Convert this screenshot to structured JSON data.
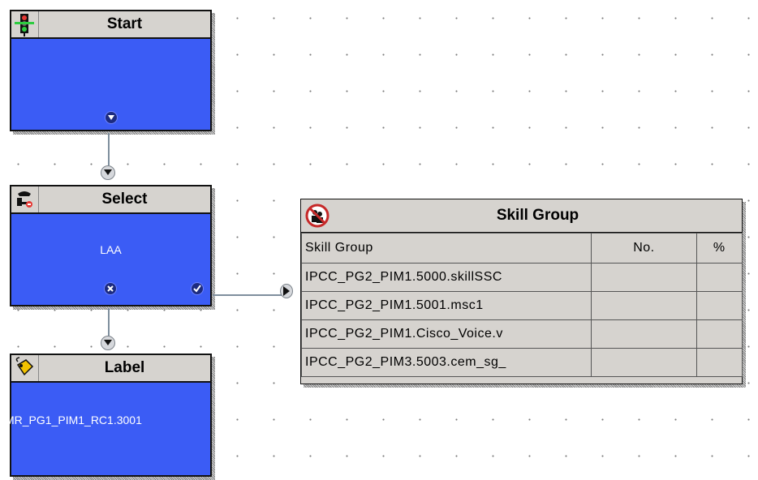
{
  "nodes": {
    "start": {
      "title": "Start",
      "icon": "traffic-light-icon",
      "connector": "down-arrow-icon"
    },
    "select": {
      "title": "Select",
      "icon": "select-icon",
      "content": "LAA",
      "fail_connector": "x-icon",
      "success_connector": "check-icon"
    },
    "label": {
      "title": "Label",
      "icon": "label-tag-icon",
      "content": "MR_PG1_PIM1_RC1.3001"
    }
  },
  "skill_group_panel": {
    "title": "Skill Group",
    "icon": "skill-group-icon",
    "headers": [
      "Skill Group",
      "No.",
      "%"
    ],
    "rows": [
      {
        "skill_group": "IPCC_PG2_PIM1.5000.skillSSC",
        "no": "",
        "pct": ""
      },
      {
        "skill_group": "IPCC_PG2_PIM1.5001.msc1",
        "no": "",
        "pct": ""
      },
      {
        "skill_group": "IPCC_PG2_PIM1.Cisco_Voice.v",
        "no": "",
        "pct": ""
      },
      {
        "skill_group": "IPCC_PG2_PIM3.5003.cem_sg_",
        "no": "",
        "pct": ""
      }
    ]
  },
  "colors": {
    "node_body": "#3b5cf5",
    "title_bar": "#d6d3cf",
    "wire": "#7f8f9d"
  }
}
